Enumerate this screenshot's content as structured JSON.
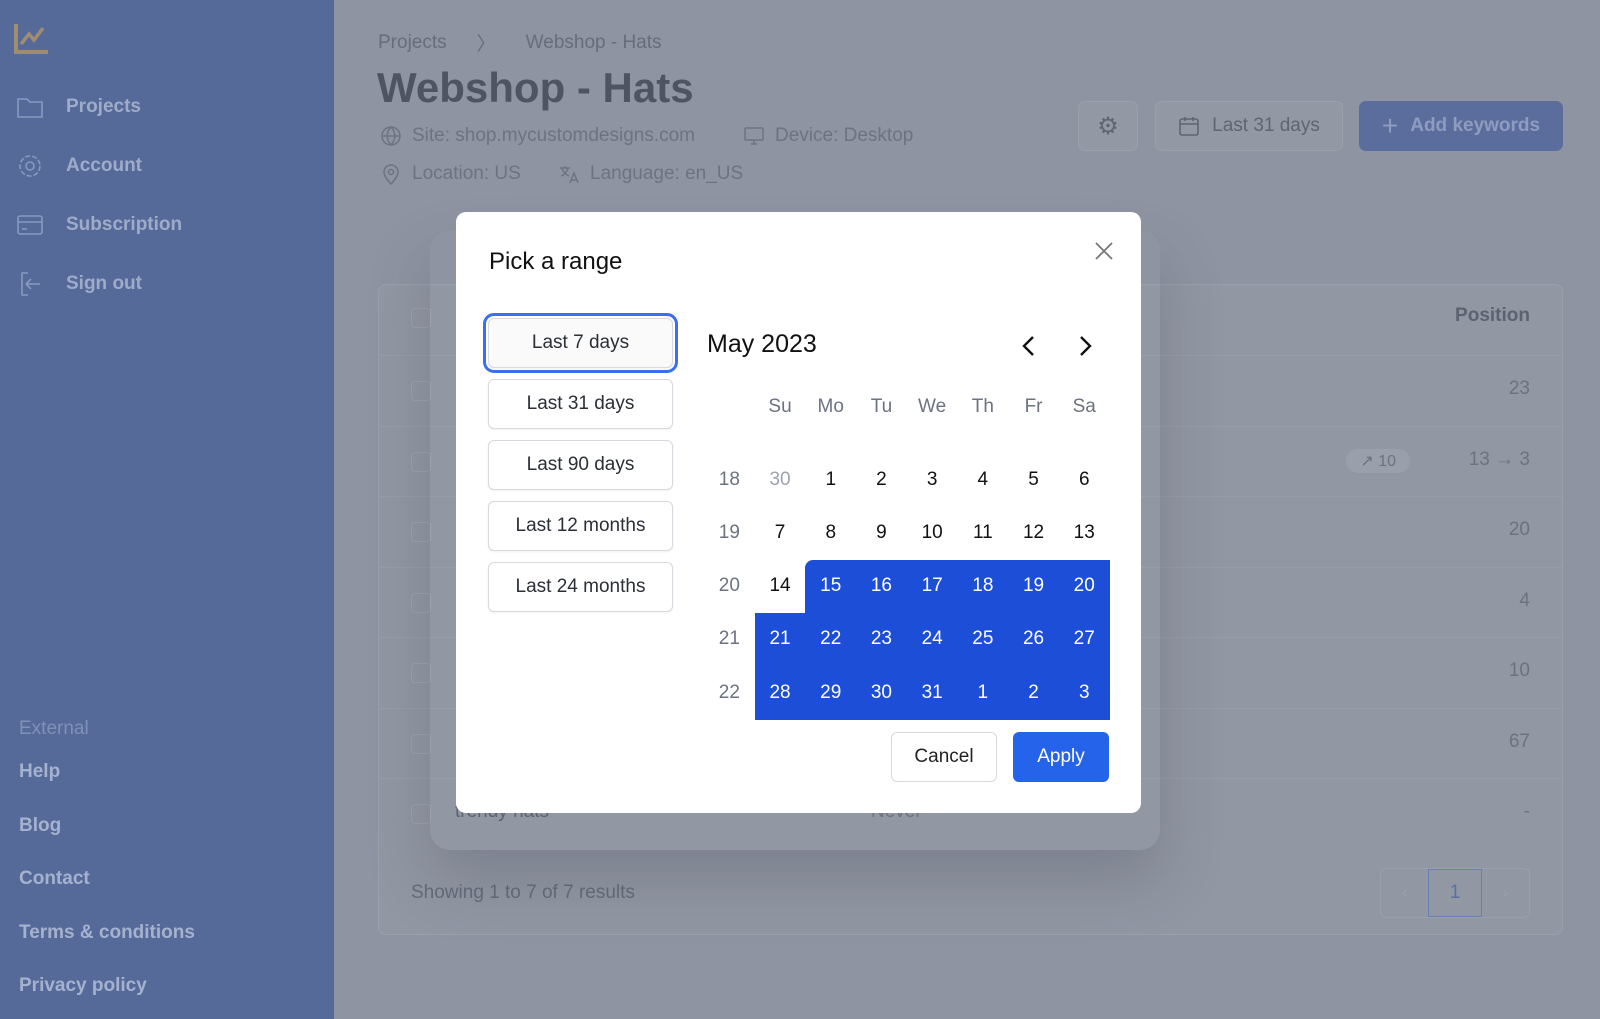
{
  "sidebar": {
    "items": [
      {
        "label": "Projects",
        "icon": "folder-icon"
      },
      {
        "label": "Account",
        "icon": "gear-icon"
      },
      {
        "label": "Subscription",
        "icon": "credit-card-icon"
      },
      {
        "label": "Sign out",
        "icon": "sign-out-icon"
      }
    ],
    "external_heading": "External",
    "external": [
      "Help",
      "Blog",
      "Contact",
      "Terms & conditions",
      "Privacy policy"
    ]
  },
  "breadcrumb": [
    "Projects",
    "Webshop - Hats"
  ],
  "page_title": "Webshop - Hats",
  "meta": {
    "site": "Site: shop.mycustomdesigns.com",
    "device": "Device: Desktop",
    "location": "Location: US",
    "language": "Language: en_US"
  },
  "toolbar": {
    "range_label": "Last 31 days",
    "add_label": "Add keywords"
  },
  "table": {
    "position_header": "Position",
    "rows": [
      {
        "keyword": "",
        "position": "23"
      },
      {
        "keyword": "",
        "position": "13 → 3",
        "badge": "↗ 10"
      },
      {
        "keyword": "",
        "position": "20"
      },
      {
        "keyword": "",
        "position": "4"
      },
      {
        "keyword": "",
        "position": "10"
      },
      {
        "keyword": "",
        "position": "67"
      },
      {
        "keyword": "trendy hats",
        "last": "Never",
        "position": "-"
      }
    ],
    "footer": "Showing 1 to 7 of 7 results",
    "page": "1"
  },
  "modal": {
    "title": "Pick a range",
    "presets": [
      "Last 7 days",
      "Last 31 days",
      "Last 90 days",
      "Last 12 months",
      "Last 24 months"
    ],
    "active_preset": "Last 7 days",
    "month": "May 2023",
    "weekdays": [
      "Su",
      "Mo",
      "Tu",
      "We",
      "Th",
      "Fr",
      "Sa"
    ],
    "weeks": [
      {
        "wk": "18",
        "days": [
          "30",
          "1",
          "2",
          "3",
          "4",
          "5",
          "6"
        ]
      },
      {
        "wk": "19",
        "days": [
          "7",
          "8",
          "9",
          "10",
          "11",
          "12",
          "13"
        ]
      },
      {
        "wk": "20",
        "days": [
          "14",
          "15",
          "16",
          "17",
          "18",
          "19",
          "20"
        ]
      },
      {
        "wk": "21",
        "days": [
          "21",
          "22",
          "23",
          "24",
          "25",
          "26",
          "27"
        ]
      },
      {
        "wk": "22",
        "days": [
          "28",
          "29",
          "30",
          "31",
          "1",
          "2",
          "3"
        ]
      }
    ],
    "selected_range": "May 15 – Jun 3",
    "cancel": "Cancel",
    "apply": "Apply"
  },
  "colors": {
    "accent": "#1d4ed8",
    "apply": "#2563eb"
  }
}
